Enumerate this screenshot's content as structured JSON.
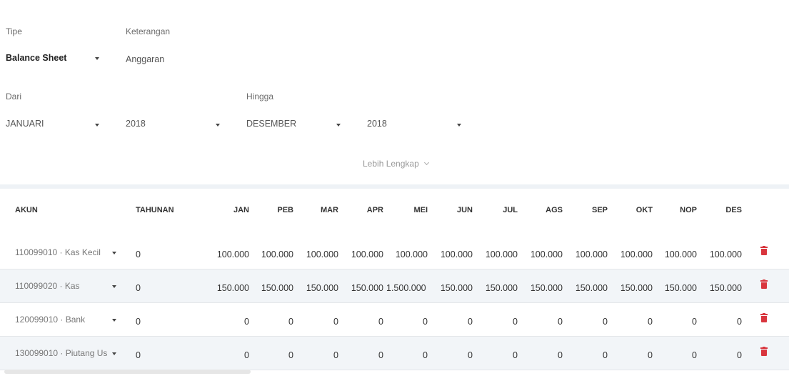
{
  "filters": {
    "tipe_label": "Tipe",
    "tipe_value": "Balance Sheet",
    "keterangan_label": "Keterangan",
    "keterangan_value": "Anggaran",
    "dari_label": "Dari",
    "dari_month": "JANUARI",
    "dari_year": "2018",
    "hingga_label": "Hingga",
    "hingga_month": "DESEMBER",
    "hingga_year": "2018"
  },
  "more_link": "Lebih Lengkap",
  "table": {
    "headers": [
      "AKUN",
      "TAHUNAN",
      "JAN",
      "PEB",
      "MAR",
      "APR",
      "MEI",
      "JUN",
      "JUL",
      "AGS",
      "SEP",
      "OKT",
      "NOP",
      "DES"
    ],
    "rows": [
      {
        "account": "110099010 · Kas Kecil",
        "tahunan": "0",
        "months": [
          "100.000",
          "100.000",
          "100.000",
          "100.000",
          "100.000",
          "100.000",
          "100.000",
          "100.000",
          "100.000",
          "100.000",
          "100.000",
          "100.000"
        ]
      },
      {
        "account": "110099020 · Kas",
        "tahunan": "0",
        "months": [
          "150.000",
          "150.000",
          "150.000",
          "150.000",
          "1.500.000",
          "150.000",
          "150.000",
          "150.000",
          "150.000",
          "150.000",
          "150.000",
          "150.000"
        ]
      },
      {
        "account": "120099010 · Bank",
        "tahunan": "0",
        "months": [
          "0",
          "0",
          "0",
          "0",
          "0",
          "0",
          "0",
          "0",
          "0",
          "0",
          "0",
          "0"
        ]
      },
      {
        "account": "130099010 · Piutang Us...",
        "tahunan": "0",
        "months": [
          "0",
          "0",
          "0",
          "0",
          "0",
          "0",
          "0",
          "0",
          "0",
          "0",
          "0",
          "0"
        ]
      }
    ]
  },
  "colors": {
    "delete": "#d9363e",
    "row_alt": "#f2f5f8"
  }
}
